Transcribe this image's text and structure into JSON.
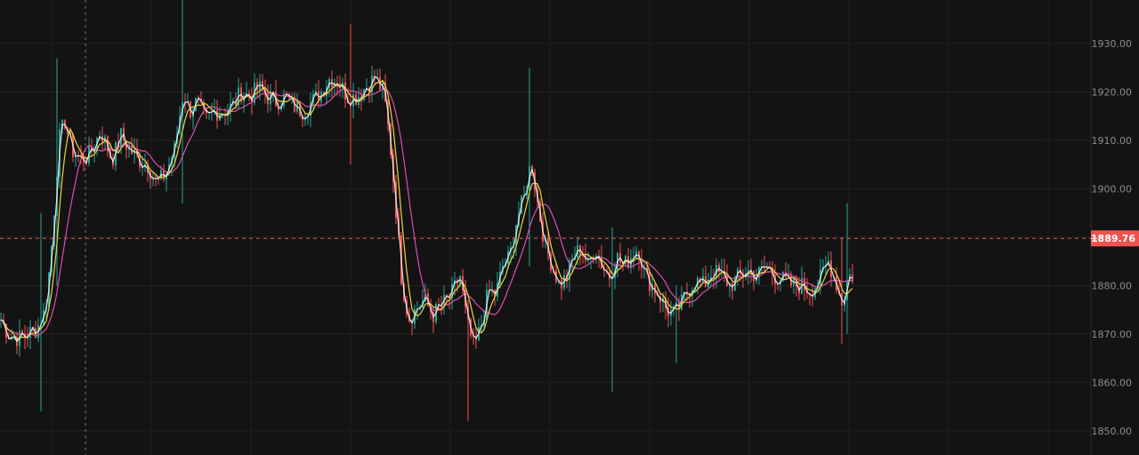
{
  "chart_data": {
    "type": "candlestick",
    "ylim": [
      1845,
      1939
    ],
    "y_ticks": [
      "1930.00",
      "1920.00",
      "1910.00",
      "1900.00",
      "1890.00",
      "1880.00",
      "1870.00",
      "1860.00",
      "1850.00"
    ],
    "grid": true,
    "last_price": "1889.76",
    "colors": {
      "background": "#131313",
      "up": "#26a69a",
      "down": "#ef5350",
      "price_line": "#ef5350",
      "ma_fast": "#e6e6e6",
      "ma_mid": "#f0d43a",
      "ma_slow": "#d94fb0"
    },
    "price_path": [
      [
        0,
        1873
      ],
      [
        8,
        1870
      ],
      [
        20,
        1869
      ],
      [
        40,
        1871
      ],
      [
        50,
        1875
      ],
      [
        58,
        1890
      ],
      [
        65,
        1910
      ],
      [
        72,
        1914
      ],
      [
        80,
        1908
      ],
      [
        90,
        1906
      ],
      [
        100,
        1907
      ],
      [
        112,
        1912
      ],
      [
        125,
        1906
      ],
      [
        135,
        1911
      ],
      [
        145,
        1908
      ],
      [
        155,
        1906
      ],
      [
        165,
        1905
      ],
      [
        175,
        1901
      ],
      [
        185,
        1903
      ],
      [
        195,
        1908
      ],
      [
        205,
        1920
      ],
      [
        212,
        1916
      ],
      [
        220,
        1918
      ],
      [
        230,
        1914
      ],
      [
        240,
        1916
      ],
      [
        250,
        1916
      ],
      [
        260,
        1917
      ],
      [
        270,
        1920
      ],
      [
        280,
        1919
      ],
      [
        290,
        1921
      ],
      [
        300,
        1919
      ],
      [
        310,
        1918
      ],
      [
        320,
        1919
      ],
      [
        330,
        1917
      ],
      [
        340,
        1916
      ],
      [
        350,
        1918
      ],
      [
        360,
        1920
      ],
      [
        370,
        1923
      ],
      [
        380,
        1922
      ],
      [
        390,
        1919
      ],
      [
        400,
        1919
      ],
      [
        410,
        1921
      ],
      [
        420,
        1923
      ],
      [
        430,
        1920
      ],
      [
        437,
        1910
      ],
      [
        443,
        1898
      ],
      [
        450,
        1882
      ],
      [
        458,
        1873
      ],
      [
        466,
        1875
      ],
      [
        476,
        1877
      ],
      [
        486,
        1874
      ],
      [
        496,
        1876
      ],
      [
        506,
        1878
      ],
      [
        516,
        1882
      ],
      [
        524,
        1872
      ],
      [
        532,
        1867
      ],
      [
        540,
        1872
      ],
      [
        548,
        1879
      ],
      [
        556,
        1878
      ],
      [
        564,
        1884
      ],
      [
        572,
        1886
      ],
      [
        580,
        1894
      ],
      [
        588,
        1898
      ],
      [
        596,
        1906
      ],
      [
        604,
        1896
      ],
      [
        612,
        1888
      ],
      [
        620,
        1884
      ],
      [
        628,
        1880
      ],
      [
        636,
        1882
      ],
      [
        644,
        1886
      ],
      [
        652,
        1888
      ],
      [
        660,
        1884
      ],
      [
        668,
        1888
      ],
      [
        676,
        1884
      ],
      [
        684,
        1882
      ],
      [
        692,
        1886
      ],
      [
        700,
        1884
      ],
      [
        708,
        1886
      ],
      [
        716,
        1888
      ],
      [
        724,
        1882
      ],
      [
        732,
        1880
      ],
      [
        740,
        1878
      ],
      [
        748,
        1875
      ],
      [
        756,
        1874
      ],
      [
        764,
        1876
      ],
      [
        772,
        1879
      ],
      [
        780,
        1881
      ],
      [
        790,
        1880
      ],
      [
        800,
        1883
      ],
      [
        810,
        1882
      ],
      [
        820,
        1880
      ],
      [
        830,
        1882
      ],
      [
        840,
        1883
      ],
      [
        850,
        1882
      ],
      [
        860,
        1884
      ],
      [
        870,
        1882
      ],
      [
        880,
        1881
      ],
      [
        890,
        1880
      ],
      [
        900,
        1880
      ],
      [
        910,
        1879
      ],
      [
        920,
        1881
      ],
      [
        930,
        1885
      ],
      [
        938,
        1881
      ],
      [
        946,
        1876
      ],
      [
        952,
        1882
      ],
      [
        957,
        1882
      ]
    ],
    "spikes": [
      [
        46,
        1854,
        1895
      ],
      [
        64,
        1880,
        1927
      ],
      [
        203,
        1897,
        1939
      ],
      [
        392,
        1905,
        1934
      ],
      [
        524,
        1852,
        1877
      ],
      [
        595,
        1884,
        1925
      ],
      [
        686,
        1858,
        1892
      ],
      [
        758,
        1864,
        1880
      ],
      [
        944,
        1868,
        1890
      ],
      [
        952,
        1870,
        1897
      ]
    ]
  }
}
